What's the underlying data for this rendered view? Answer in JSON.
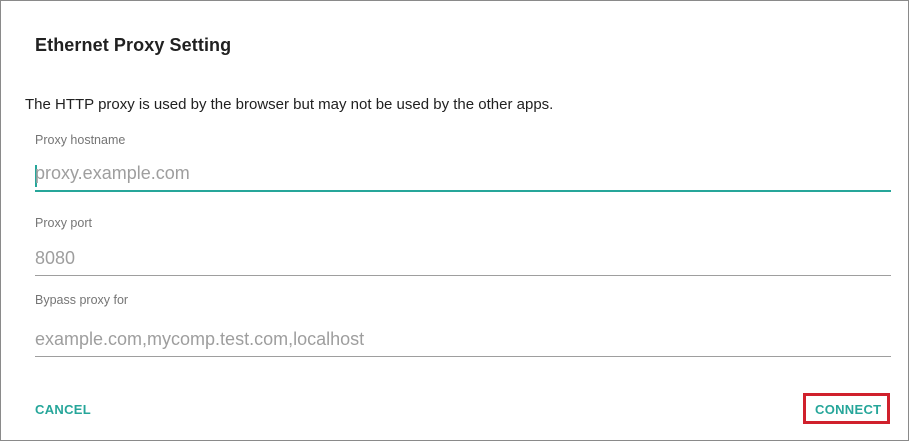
{
  "dialog": {
    "title": "Ethernet Proxy Setting",
    "message": "The HTTP proxy is used by the browser but may not be used by the other apps.",
    "fields": [
      {
        "label": "Proxy hostname",
        "value": "",
        "placeholder": "proxy.example.com"
      },
      {
        "label": "Proxy port",
        "value": "",
        "placeholder": "8080"
      },
      {
        "label": "Bypass proxy for",
        "value": "",
        "placeholder": "example.com,mycomp.test.com,localhost"
      }
    ],
    "buttons": {
      "cancel_label": "CANCEL",
      "connect_label": "CONNECT"
    }
  },
  "colors": {
    "accent": "#26a69a",
    "highlight_box": "#d0202c",
    "text_primary": "#212121",
    "text_secondary": "#757575",
    "hint": "#9e9e9e"
  }
}
